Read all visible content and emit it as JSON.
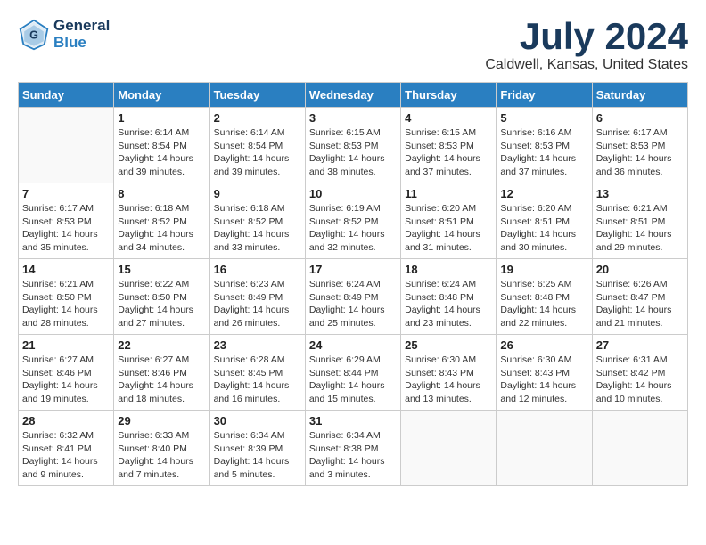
{
  "header": {
    "logo_line1": "General",
    "logo_line2": "Blue",
    "month_title": "July 2024",
    "location": "Caldwell, Kansas, United States"
  },
  "weekdays": [
    "Sunday",
    "Monday",
    "Tuesday",
    "Wednesday",
    "Thursday",
    "Friday",
    "Saturday"
  ],
  "weeks": [
    [
      {
        "day": "",
        "info": ""
      },
      {
        "day": "1",
        "info": "Sunrise: 6:14 AM\nSunset: 8:54 PM\nDaylight: 14 hours\nand 39 minutes."
      },
      {
        "day": "2",
        "info": "Sunrise: 6:14 AM\nSunset: 8:54 PM\nDaylight: 14 hours\nand 39 minutes."
      },
      {
        "day": "3",
        "info": "Sunrise: 6:15 AM\nSunset: 8:53 PM\nDaylight: 14 hours\nand 38 minutes."
      },
      {
        "day": "4",
        "info": "Sunrise: 6:15 AM\nSunset: 8:53 PM\nDaylight: 14 hours\nand 37 minutes."
      },
      {
        "day": "5",
        "info": "Sunrise: 6:16 AM\nSunset: 8:53 PM\nDaylight: 14 hours\nand 37 minutes."
      },
      {
        "day": "6",
        "info": "Sunrise: 6:17 AM\nSunset: 8:53 PM\nDaylight: 14 hours\nand 36 minutes."
      }
    ],
    [
      {
        "day": "7",
        "info": "Sunrise: 6:17 AM\nSunset: 8:53 PM\nDaylight: 14 hours\nand 35 minutes."
      },
      {
        "day": "8",
        "info": "Sunrise: 6:18 AM\nSunset: 8:52 PM\nDaylight: 14 hours\nand 34 minutes."
      },
      {
        "day": "9",
        "info": "Sunrise: 6:18 AM\nSunset: 8:52 PM\nDaylight: 14 hours\nand 33 minutes."
      },
      {
        "day": "10",
        "info": "Sunrise: 6:19 AM\nSunset: 8:52 PM\nDaylight: 14 hours\nand 32 minutes."
      },
      {
        "day": "11",
        "info": "Sunrise: 6:20 AM\nSunset: 8:51 PM\nDaylight: 14 hours\nand 31 minutes."
      },
      {
        "day": "12",
        "info": "Sunrise: 6:20 AM\nSunset: 8:51 PM\nDaylight: 14 hours\nand 30 minutes."
      },
      {
        "day": "13",
        "info": "Sunrise: 6:21 AM\nSunset: 8:51 PM\nDaylight: 14 hours\nand 29 minutes."
      }
    ],
    [
      {
        "day": "14",
        "info": "Sunrise: 6:21 AM\nSunset: 8:50 PM\nDaylight: 14 hours\nand 28 minutes."
      },
      {
        "day": "15",
        "info": "Sunrise: 6:22 AM\nSunset: 8:50 PM\nDaylight: 14 hours\nand 27 minutes."
      },
      {
        "day": "16",
        "info": "Sunrise: 6:23 AM\nSunset: 8:49 PM\nDaylight: 14 hours\nand 26 minutes."
      },
      {
        "day": "17",
        "info": "Sunrise: 6:24 AM\nSunset: 8:49 PM\nDaylight: 14 hours\nand 25 minutes."
      },
      {
        "day": "18",
        "info": "Sunrise: 6:24 AM\nSunset: 8:48 PM\nDaylight: 14 hours\nand 23 minutes."
      },
      {
        "day": "19",
        "info": "Sunrise: 6:25 AM\nSunset: 8:48 PM\nDaylight: 14 hours\nand 22 minutes."
      },
      {
        "day": "20",
        "info": "Sunrise: 6:26 AM\nSunset: 8:47 PM\nDaylight: 14 hours\nand 21 minutes."
      }
    ],
    [
      {
        "day": "21",
        "info": "Sunrise: 6:27 AM\nSunset: 8:46 PM\nDaylight: 14 hours\nand 19 minutes."
      },
      {
        "day": "22",
        "info": "Sunrise: 6:27 AM\nSunset: 8:46 PM\nDaylight: 14 hours\nand 18 minutes."
      },
      {
        "day": "23",
        "info": "Sunrise: 6:28 AM\nSunset: 8:45 PM\nDaylight: 14 hours\nand 16 minutes."
      },
      {
        "day": "24",
        "info": "Sunrise: 6:29 AM\nSunset: 8:44 PM\nDaylight: 14 hours\nand 15 minutes."
      },
      {
        "day": "25",
        "info": "Sunrise: 6:30 AM\nSunset: 8:43 PM\nDaylight: 14 hours\nand 13 minutes."
      },
      {
        "day": "26",
        "info": "Sunrise: 6:30 AM\nSunset: 8:43 PM\nDaylight: 14 hours\nand 12 minutes."
      },
      {
        "day": "27",
        "info": "Sunrise: 6:31 AM\nSunset: 8:42 PM\nDaylight: 14 hours\nand 10 minutes."
      }
    ],
    [
      {
        "day": "28",
        "info": "Sunrise: 6:32 AM\nSunset: 8:41 PM\nDaylight: 14 hours\nand 9 minutes."
      },
      {
        "day": "29",
        "info": "Sunrise: 6:33 AM\nSunset: 8:40 PM\nDaylight: 14 hours\nand 7 minutes."
      },
      {
        "day": "30",
        "info": "Sunrise: 6:34 AM\nSunset: 8:39 PM\nDaylight: 14 hours\nand 5 minutes."
      },
      {
        "day": "31",
        "info": "Sunrise: 6:34 AM\nSunset: 8:38 PM\nDaylight: 14 hours\nand 3 minutes."
      },
      {
        "day": "",
        "info": ""
      },
      {
        "day": "",
        "info": ""
      },
      {
        "day": "",
        "info": ""
      }
    ]
  ]
}
